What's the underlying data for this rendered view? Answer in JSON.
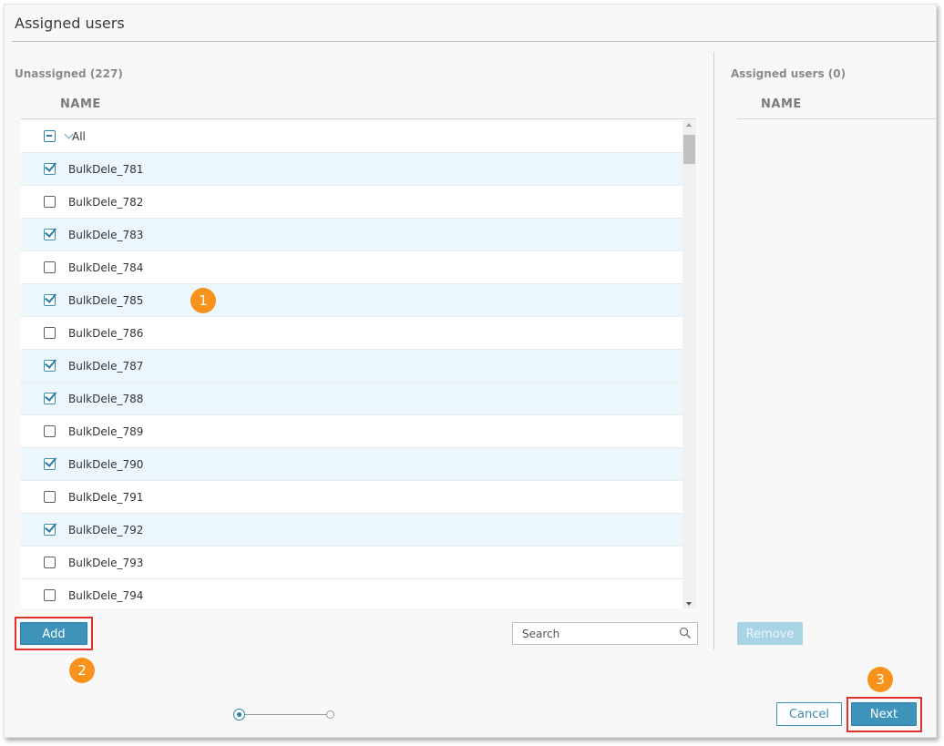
{
  "dialog": {
    "title": "Assigned users"
  },
  "unassigned": {
    "title": "Unassigned (227)",
    "column_name": "NAME",
    "all_label": "All",
    "rows": [
      {
        "label": "BulkDele_781",
        "checked": true
      },
      {
        "label": "BulkDele_782",
        "checked": false
      },
      {
        "label": "BulkDele_783",
        "checked": true
      },
      {
        "label": "BulkDele_784",
        "checked": false
      },
      {
        "label": "BulkDele_785",
        "checked": true
      },
      {
        "label": "BulkDele_786",
        "checked": false
      },
      {
        "label": "BulkDele_787",
        "checked": true
      },
      {
        "label": "BulkDele_788",
        "checked": true
      },
      {
        "label": "BulkDele_789",
        "checked": false
      },
      {
        "label": "BulkDele_790",
        "checked": true
      },
      {
        "label": "BulkDele_791",
        "checked": false
      },
      {
        "label": "BulkDele_792",
        "checked": true
      },
      {
        "label": "BulkDele_793",
        "checked": false
      },
      {
        "label": "BulkDele_794",
        "checked": false
      }
    ],
    "add_label": "Add",
    "search_placeholder": "Search"
  },
  "assigned": {
    "title": "Assigned users (0)",
    "column_name": "NAME",
    "remove_label": "Remove"
  },
  "footer": {
    "cancel_label": "Cancel",
    "next_label": "Next"
  },
  "callouts": {
    "one": "1",
    "two": "2",
    "three": "3"
  },
  "colors": {
    "accent": "#3d93b9",
    "selected_row": "#ebf6fd",
    "callout": "#f7931d",
    "highlight": "#e0322d"
  }
}
